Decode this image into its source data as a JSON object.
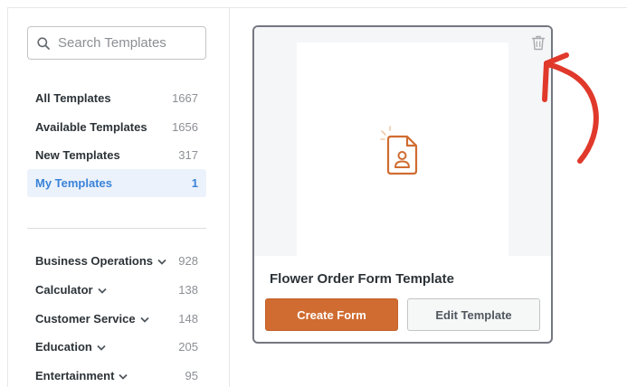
{
  "search": {
    "placeholder": "Search Templates",
    "value": ""
  },
  "nav": [
    {
      "label": "All Templates",
      "count": "1667",
      "active": false
    },
    {
      "label": "Available Templates",
      "count": "1656",
      "active": false
    },
    {
      "label": "New Templates",
      "count": "317",
      "active": false
    },
    {
      "label": "My Templates",
      "count": "1",
      "active": true
    }
  ],
  "categories": [
    {
      "label": "Business Operations",
      "count": "928"
    },
    {
      "label": "Calculator",
      "count": "138"
    },
    {
      "label": "Customer Service",
      "count": "148"
    },
    {
      "label": "Education",
      "count": "205"
    },
    {
      "label": "Entertainment",
      "count": "95"
    }
  ],
  "card": {
    "title": "Flower Order Form Template",
    "primary_label": "Create Form",
    "secondary_label": "Edit Template",
    "preview_icon": "form-document-icon",
    "delete_icon": "trash-icon"
  },
  "annotation": {
    "icon": "curved-arrow-icon",
    "color": "#e0392b"
  },
  "colors": {
    "accent": "#d06c31",
    "active": "#3a82d8",
    "active_bg": "#ecf2fb"
  }
}
